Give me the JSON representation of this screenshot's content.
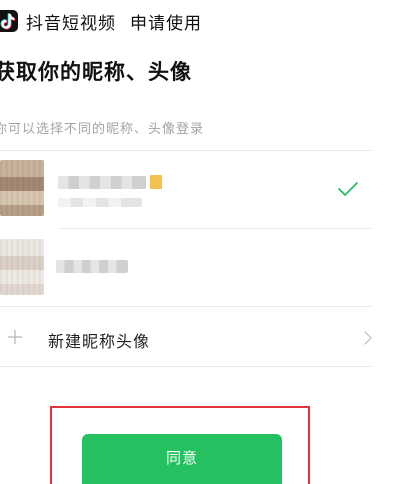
{
  "header": {
    "app_name": "抖音短视频",
    "request_text": "申请使用",
    "logo_icon": "douyin-logo-icon"
  },
  "page": {
    "title": "获取你的昵称、头像",
    "subtitle": "你可以选择不同的昵称、头像登录"
  },
  "profiles": [
    {
      "selected": true,
      "check_icon": "check-icon",
      "check_color": "#25c160"
    },
    {
      "selected": false
    }
  ],
  "new_option": {
    "label": "新建昵称头像",
    "plus_icon": "plus-icon",
    "chevron_icon": "chevron-right-icon"
  },
  "agree_button": {
    "label": "同意",
    "color": "#25c160"
  },
  "highlight_color": "#e0333b"
}
